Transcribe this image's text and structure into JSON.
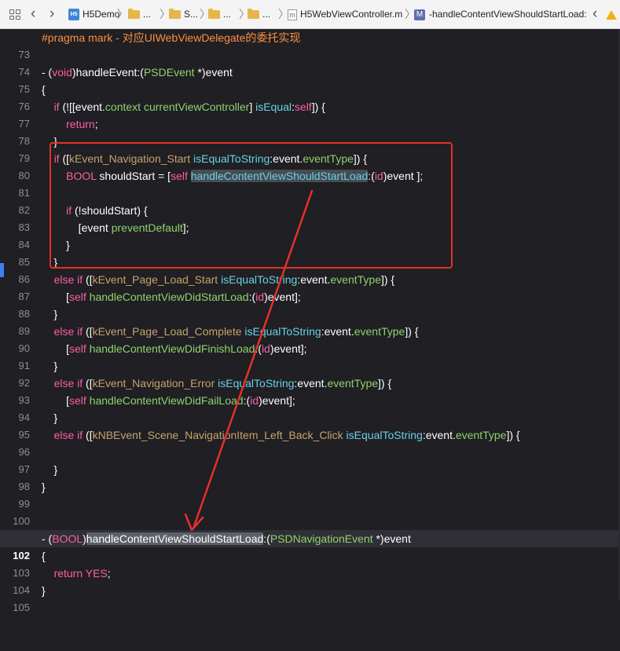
{
  "jumpbar": {
    "crumbs": [
      "H5Demo",
      "...",
      "S...",
      "...",
      "...",
      "H5WebViewController.m",
      "-handleContentViewShouldStartLoad:"
    ],
    "icons": [
      "grid-icon",
      "back-arrow-icon",
      "forward-arrow-icon",
      "project-icon",
      "folder-icon",
      "objc-file-icon",
      "method-icon",
      "warning-icon"
    ],
    "method_box_letter": "M",
    "m_file_letter": "m",
    "back": "‹",
    "forward": "›",
    "sep": "〉",
    "prev_issue": "‹"
  },
  "editor": {
    "current_line": "102",
    "lines": [
      {
        "n": "73"
      },
      {
        "n": "74"
      },
      {
        "n": "75"
      },
      {
        "n": "76"
      },
      {
        "n": "77"
      },
      {
        "n": "78"
      },
      {
        "n": "79"
      },
      {
        "n": "80"
      },
      {
        "n": "81"
      },
      {
        "n": "82"
      },
      {
        "n": "83"
      },
      {
        "n": "84"
      },
      {
        "n": "85"
      },
      {
        "n": "86"
      },
      {
        "n": "87"
      },
      {
        "n": "88"
      },
      {
        "n": "89"
      },
      {
        "n": "90"
      },
      {
        "n": "91"
      },
      {
        "n": "92"
      },
      {
        "n": "93"
      },
      {
        "n": "94"
      },
      {
        "n": "95"
      },
      {
        "n": "96"
      },
      {
        "n": "97"
      },
      {
        "n": "98"
      },
      {
        "n": "99"
      },
      {
        "n": "100"
      },
      {
        "n": "101"
      },
      {
        "n": "102"
      },
      {
        "n": "103"
      },
      {
        "n": "104"
      },
      {
        "n": "105"
      }
    ]
  },
  "code": {
    "l73": [
      "#pragma mark - 对应UIWebViewDelegate的委托实现"
    ],
    "l75": [
      "- (",
      "void",
      ")handleEvent:(",
      "PSDEvent",
      " *)event"
    ],
    "l76": [
      "{"
    ],
    "l77": [
      "    ",
      "if",
      " (![[event.",
      "context",
      " ",
      "currentViewController",
      "] ",
      "isEqual",
      ":",
      "self",
      "]) {"
    ],
    "l78": [
      "        ",
      "return",
      ";"
    ],
    "l79": [
      "    }"
    ],
    "l80": [
      "    ",
      "if",
      " ([",
      "kEvent_Navigation_Start",
      " ",
      "isEqualToString",
      ":event.",
      "eventType",
      "]) {"
    ],
    "l81": [
      "        ",
      "BOOL",
      " shouldStart = [",
      "self",
      " ",
      "handleContentViewShouldStartLoad",
      ":(",
      "id",
      ")event ];"
    ],
    "l83": [
      "        ",
      "if",
      " (!shouldStart) {"
    ],
    "l84": [
      "            [event ",
      "preventDefault",
      "];"
    ],
    "l85": [
      "        }"
    ],
    "l86": [
      "    }"
    ],
    "l87": [
      "    ",
      "else if",
      " ([",
      "kEvent_Page_Load_Start",
      " ",
      "isEqualToString",
      ":event.",
      "eventType",
      "]) {"
    ],
    "l88": [
      "        [",
      "self",
      " ",
      "handleContentViewDidStartLoad",
      ":(",
      "id",
      ")event];"
    ],
    "l89": [
      "    }"
    ],
    "l90": [
      "    ",
      "else if",
      " ([",
      "kEvent_Page_Load_Complete",
      " ",
      "isEqualToString",
      ":event.",
      "eventType",
      "]) {"
    ],
    "l91": [
      "        [",
      "self",
      " ",
      "handleContentViewDidFinishLoad",
      ":(",
      "id",
      ")event];"
    ],
    "l92": [
      "    }"
    ],
    "l93": [
      "    ",
      "else if",
      " ([",
      "kEvent_Navigation_Error",
      " ",
      "isEqualToString",
      ":event.",
      "eventType",
      "]) {"
    ],
    "l94": [
      "        [",
      "self",
      " ",
      "handleContentViewDidFailLoad",
      ":(",
      "id",
      ")event];"
    ],
    "l95": [
      "    }"
    ],
    "l96": [
      "    ",
      "else if",
      " ([",
      "kNBEvent_Scene_NavigationItem_Left_Back_Click",
      " ",
      "isEqualToString",
      ":event.",
      "eventType",
      "]) {"
    ],
    "l98": [
      "    }"
    ],
    "l99": [
      "}"
    ],
    "l102": [
      "- (",
      "BOOL",
      ")",
      "handleContentViewShouldStartLoad",
      ":(",
      "PSDNavigationEvent",
      " *)event"
    ],
    "l103": [
      "{"
    ],
    "l104": [
      "    ",
      "return",
      " ",
      "YES",
      ";"
    ],
    "l105": [
      "}"
    ]
  },
  "colors": {
    "background": "#1f1f24",
    "current_line": "#2f2f37",
    "keyword": "#fc5fa3",
    "type": "#8fd36b",
    "constant": "#c7a36a",
    "method": "#6ad1e3",
    "pragma": "#fd8f3f",
    "annotation_red": "#e5302a",
    "gutter_marker": "#3f7ef2"
  }
}
